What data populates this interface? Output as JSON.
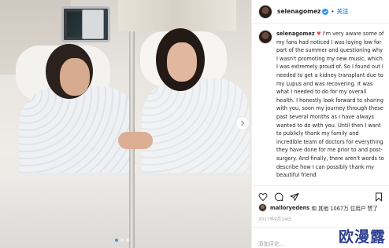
{
  "colors": {
    "accent": "#3897f0",
    "text": "#262626",
    "muted": "#999999",
    "watermark": "#2d3f8f"
  },
  "header": {
    "username": "selenagomez",
    "separator": "•",
    "follow_label": "关注",
    "icons": [
      "avatar",
      "verified-badge-icon"
    ]
  },
  "caption": {
    "username": "selenagomez",
    "body": "I'm very aware some of my fans had noticed I was laying low for part of the summer and questioning why I wasn't promoting my new music, which I was extremely proud of. So I found out I needed to get a kidney transplant due to my Lupus and was recovering. It was what I needed to do for my overall health. I honestly look forward to sharing with you, soon my journey through these past several months as I have always wanted to do with you. Until then I want to publicly thank my family and incredible team of doctors for everything they have done for me prior to and post-surgery. And finally, there aren't words to describe how I can possibly thank my beautiful friend"
  },
  "actions": {
    "icons": [
      "heart-icon",
      "comment-icon",
      "share-icon",
      "bookmark-icon"
    ]
  },
  "likes": {
    "user": "malloryedens",
    "text": "和 其他 1067万 位用户 赞了"
  },
  "date": "2017年9月14日",
  "comment": {
    "placeholder": "添加评论..."
  },
  "watermark": "欧漫露"
}
